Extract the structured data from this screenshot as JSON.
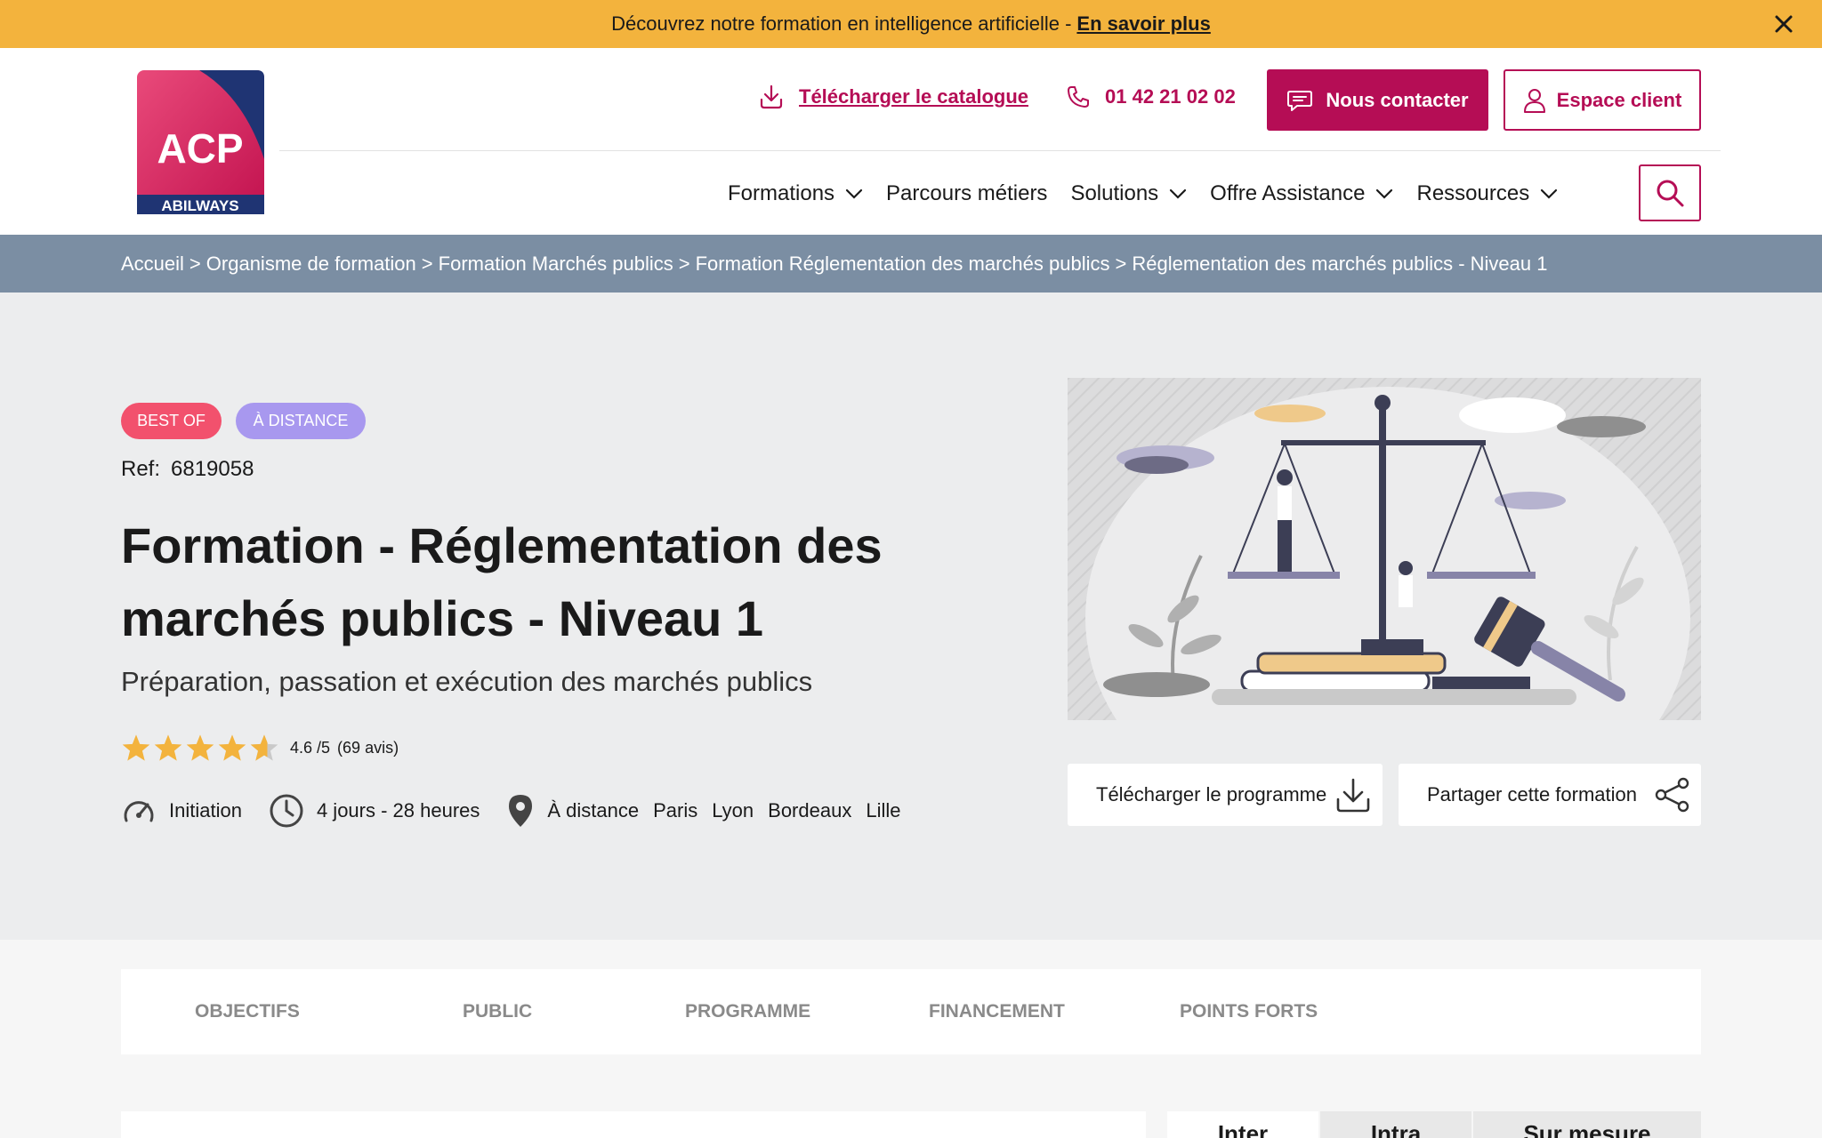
{
  "promo": {
    "text": "Découvrez notre formation en intelligence artificielle -",
    "link": "En savoir plus"
  },
  "header": {
    "logo_text": "ACP",
    "logo_subtext": "ABILWAYS",
    "catalog_link": "Télécharger le catalogue",
    "phone": "01 42 21 02 02",
    "contact_button": "Nous contacter",
    "client_button": "Espace client",
    "nav": [
      {
        "label": "Formations",
        "has_dropdown": true
      },
      {
        "label": "Parcours métiers",
        "has_dropdown": false
      },
      {
        "label": "Solutions",
        "has_dropdown": true
      },
      {
        "label": "Offre Assistance",
        "has_dropdown": true
      },
      {
        "label": "Ressources",
        "has_dropdown": true
      }
    ]
  },
  "breadcrumb": [
    "Accueil",
    "Organisme de formation",
    "Formation Marchés publics",
    "Formation Réglementation des marchés publics",
    "Réglementation des marchés publics - Niveau 1"
  ],
  "breadcrumb_separator": ">",
  "course": {
    "badges": [
      "BEST OF",
      "À DISTANCE"
    ],
    "ref_label": "Ref:",
    "ref_value": "6819058",
    "title": "Formation - Réglementation des marchés publics - Niveau 1",
    "subtitle": "Préparation, passation et exécution des marchés publics",
    "rating_value": 4.6,
    "rating_text": "4.6 /5",
    "rating_count": "(69 avis)",
    "level": "Initiation",
    "duration": "4 jours - 28 heures",
    "locations": [
      "À distance",
      "Paris",
      "Lyon",
      "Bordeaux",
      "Lille"
    ],
    "download_program": "Télécharger le programme",
    "share": "Partager cette formation"
  },
  "tabs": [
    "OBJECTIFS",
    "PUBLIC",
    "PROGRAMME",
    "FINANCEMENT",
    "POINTS FORTS"
  ],
  "session_types": [
    "Inter",
    "Intra",
    "Sur mesure"
  ],
  "colors": {
    "brand": "#b50d55",
    "promo_bg": "#f3b33d",
    "breadcrumb_bg": "#7b8ea3",
    "hero_bg": "#ecedee",
    "badge_best": "#f2516d",
    "badge_distance": "#a898ef",
    "star": "#f3b33d"
  }
}
